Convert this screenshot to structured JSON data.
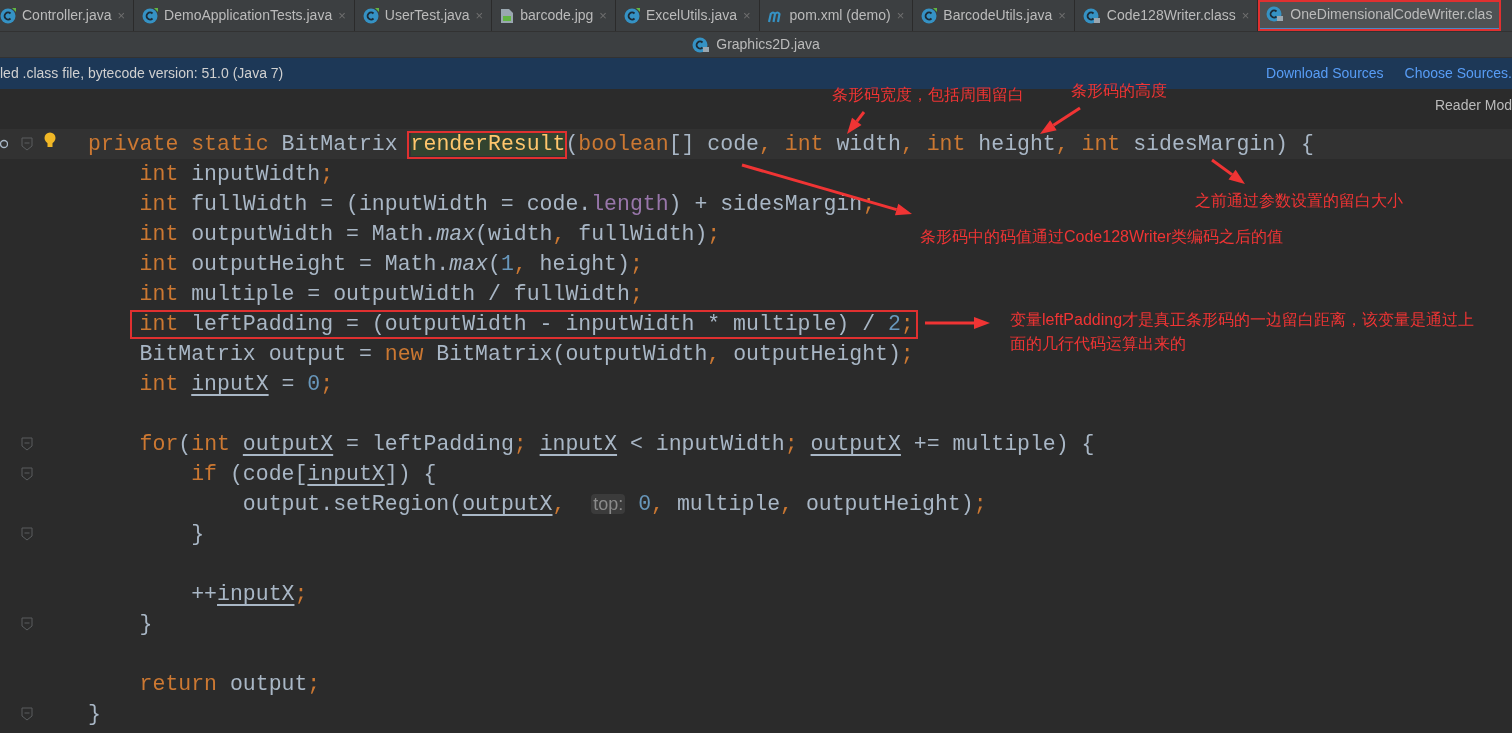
{
  "tabs": [
    {
      "label": "Controller.java",
      "kind": "class",
      "close": "×",
      "selected": false,
      "boxed": false
    },
    {
      "label": "DemoApplicationTests.java",
      "kind": "class",
      "close": "×",
      "selected": false,
      "boxed": false
    },
    {
      "label": "UserTest.java",
      "kind": "class",
      "close": "×",
      "selected": false,
      "boxed": false
    },
    {
      "label": "barcode.jpg",
      "kind": "image",
      "close": "×",
      "selected": false,
      "boxed": false
    },
    {
      "label": "ExcelUtils.java",
      "kind": "class",
      "close": "×",
      "selected": false,
      "boxed": false
    },
    {
      "label": "pom.xml (demo)",
      "kind": "maven",
      "close": "×",
      "selected": false,
      "boxed": false
    },
    {
      "label": "BarcodeUtils.java",
      "kind": "class",
      "close": "×",
      "selected": false,
      "boxed": false
    },
    {
      "label": "Code128Writer.class",
      "kind": "locked-class",
      "close": "×",
      "selected": false,
      "boxed": false
    },
    {
      "label": "OneDimensionalCodeWriter.clas",
      "kind": "locked-class",
      "selected": true,
      "boxed": true
    }
  ],
  "second_row_tab": {
    "label": "Graphics2D.java",
    "kind": "locked-class"
  },
  "banner": {
    "text": "led .class file, bytecode version: 51.0 (Java 7)",
    "links": [
      "Download Sources",
      "Choose Sources."
    ]
  },
  "reader_mode": "Reader Mod",
  "code_lines": [
    {
      "current": true,
      "fold": true,
      "boxed": false,
      "tokens": [
        {
          "kind": "kw",
          "text": "private static "
        },
        {
          "kind": "txt",
          "text": "BitMatrix "
        },
        {
          "kind": "method",
          "text": "renderResult",
          "boxed": true
        },
        {
          "kind": "txt",
          "text": "("
        },
        {
          "kind": "kw",
          "text": "boolean"
        },
        {
          "kind": "txt",
          "text": "[] code"
        },
        {
          "kind": "kw",
          "text": ", int "
        },
        {
          "kind": "txt",
          "text": "width"
        },
        {
          "kind": "kw",
          "text": ", int "
        },
        {
          "kind": "txt",
          "text": "height"
        },
        {
          "kind": "kw",
          "text": ", int "
        },
        {
          "kind": "txt",
          "text": "sidesMargin) {"
        }
      ]
    },
    {
      "current": false,
      "fold": false,
      "boxed": false,
      "tokens": [
        {
          "kind": "kw",
          "text": "    int "
        },
        {
          "kind": "txt",
          "text": "inputWidth"
        },
        {
          "kind": "kw",
          "text": ";"
        }
      ]
    },
    {
      "current": false,
      "fold": false,
      "boxed": false,
      "tokens": [
        {
          "kind": "kw",
          "text": "    int "
        },
        {
          "kind": "txt",
          "text": "fullWidth = (inputWidth = code."
        },
        {
          "kind": "field",
          "text": "length"
        },
        {
          "kind": "txt",
          "text": ") + sidesMargin"
        },
        {
          "kind": "kw",
          "text": ";"
        }
      ]
    },
    {
      "current": false,
      "fold": false,
      "boxed": false,
      "tokens": [
        {
          "kind": "kw",
          "text": "    int "
        },
        {
          "kind": "txt",
          "text": "outputWidth = Math."
        },
        {
          "kind": "static",
          "text": "max"
        },
        {
          "kind": "txt",
          "text": "(width"
        },
        {
          "kind": "kw",
          "text": ", "
        },
        {
          "kind": "txt",
          "text": "fullWidth)"
        },
        {
          "kind": "kw",
          "text": ";"
        }
      ]
    },
    {
      "current": false,
      "fold": false,
      "boxed": false,
      "tokens": [
        {
          "kind": "kw",
          "text": "    int "
        },
        {
          "kind": "txt",
          "text": "outputHeight = Math."
        },
        {
          "kind": "static",
          "text": "max"
        },
        {
          "kind": "txt",
          "text": "("
        },
        {
          "kind": "num",
          "text": "1"
        },
        {
          "kind": "kw",
          "text": ", "
        },
        {
          "kind": "txt",
          "text": "height)"
        },
        {
          "kind": "kw",
          "text": ";"
        }
      ]
    },
    {
      "current": false,
      "fold": false,
      "boxed": false,
      "tokens": [
        {
          "kind": "kw",
          "text": "    int "
        },
        {
          "kind": "txt",
          "text": "multiple = outputWidth / fullWidth"
        },
        {
          "kind": "kw",
          "text": ";"
        }
      ]
    },
    {
      "current": false,
      "fold": false,
      "boxed": true,
      "tokens": [
        {
          "kind": "kw",
          "text": "    int "
        },
        {
          "kind": "txt",
          "text": "leftPadding = (outputWidth - inputWidth * multiple) / "
        },
        {
          "kind": "num",
          "text": "2"
        },
        {
          "kind": "kw",
          "text": ";"
        }
      ]
    },
    {
      "current": false,
      "fold": false,
      "boxed": false,
      "tokens": [
        {
          "kind": "txt",
          "text": "    BitMatrix output = "
        },
        {
          "kind": "kw",
          "text": "new "
        },
        {
          "kind": "txt",
          "text": "BitMatrix(outputWidth"
        },
        {
          "kind": "kw",
          "text": ", "
        },
        {
          "kind": "txt",
          "text": "outputHeight)"
        },
        {
          "kind": "kw",
          "text": ";"
        }
      ]
    },
    {
      "current": false,
      "fold": false,
      "boxed": false,
      "tokens": [
        {
          "kind": "kw",
          "text": "    int "
        },
        {
          "kind": "var",
          "text": "inputX"
        },
        {
          "kind": "txt",
          "text": " = "
        },
        {
          "kind": "num",
          "text": "0"
        },
        {
          "kind": "kw",
          "text": ";"
        }
      ]
    },
    {
      "current": false,
      "fold": false,
      "boxed": false
    },
    {
      "current": false,
      "fold": true,
      "boxed": false,
      "tokens": [
        {
          "kind": "kw",
          "text": "    for"
        },
        {
          "kind": "txt",
          "text": "("
        },
        {
          "kind": "kw",
          "text": "int "
        },
        {
          "kind": "var",
          "text": "outputX"
        },
        {
          "kind": "txt",
          "text": " = leftPadding"
        },
        {
          "kind": "kw",
          "text": "; "
        },
        {
          "kind": "var",
          "text": "inputX"
        },
        {
          "kind": "txt",
          "text": " < inputWidth"
        },
        {
          "kind": "kw",
          "text": "; "
        },
        {
          "kind": "var",
          "text": "outputX"
        },
        {
          "kind": "txt",
          "text": " += multiple) {"
        }
      ]
    },
    {
      "current": false,
      "fold": true,
      "boxed": false,
      "tokens": [
        {
          "kind": "kw",
          "text": "        if "
        },
        {
          "kind": "txt",
          "text": "(code["
        },
        {
          "kind": "var",
          "text": "inputX"
        },
        {
          "kind": "txt",
          "text": "]) {"
        }
      ]
    },
    {
      "current": false,
      "fold": false,
      "boxed": false,
      "tokens": [
        {
          "kind": "txt",
          "text": "            output.setRegion("
        },
        {
          "kind": "var",
          "text": "outputX"
        },
        {
          "kind": "kw",
          "text": ",  "
        },
        {
          "kind": "hint",
          "text": "top:"
        },
        {
          "kind": "num",
          "text": " 0"
        },
        {
          "kind": "kw",
          "text": ", "
        },
        {
          "kind": "txt",
          "text": "multiple"
        },
        {
          "kind": "kw",
          "text": ", "
        },
        {
          "kind": "txt",
          "text": "outputHeight)"
        },
        {
          "kind": "kw",
          "text": ";"
        }
      ]
    },
    {
      "current": false,
      "fold": true,
      "boxed": false,
      "tokens": [
        {
          "kind": "txt",
          "text": "        }"
        }
      ]
    },
    {
      "current": false,
      "fold": false,
      "boxed": false
    },
    {
      "current": false,
      "fold": false,
      "boxed": false,
      "tokens": [
        {
          "kind": "txt",
          "text": "        ++"
        },
        {
          "kind": "var",
          "text": "inputX"
        },
        {
          "kind": "kw",
          "text": ";"
        }
      ]
    },
    {
      "current": false,
      "fold": true,
      "boxed": false,
      "tokens": [
        {
          "kind": "txt",
          "text": "    }"
        }
      ]
    },
    {
      "current": false,
      "fold": false,
      "boxed": false
    },
    {
      "current": false,
      "fold": false,
      "boxed": false,
      "tokens": [
        {
          "kind": "kw",
          "text": "    return "
        },
        {
          "kind": "txt",
          "text": "output"
        },
        {
          "kind": "kw",
          "text": ";"
        }
      ]
    },
    {
      "current": false,
      "fold": true,
      "boxed": false,
      "tokens": [
        {
          "kind": "txt",
          "text": "}"
        }
      ]
    }
  ],
  "annotations": [
    "条形码宽度，包括周围留白",
    "条形码的高度",
    "之前通过参数设置的留白大小",
    "条形码中的码值通过Code128Writer类编码之后的值",
    "变量leftPadding才是真正条形码的一边留白距离，该变量是通过上面的几行代码运算出来的"
  ]
}
